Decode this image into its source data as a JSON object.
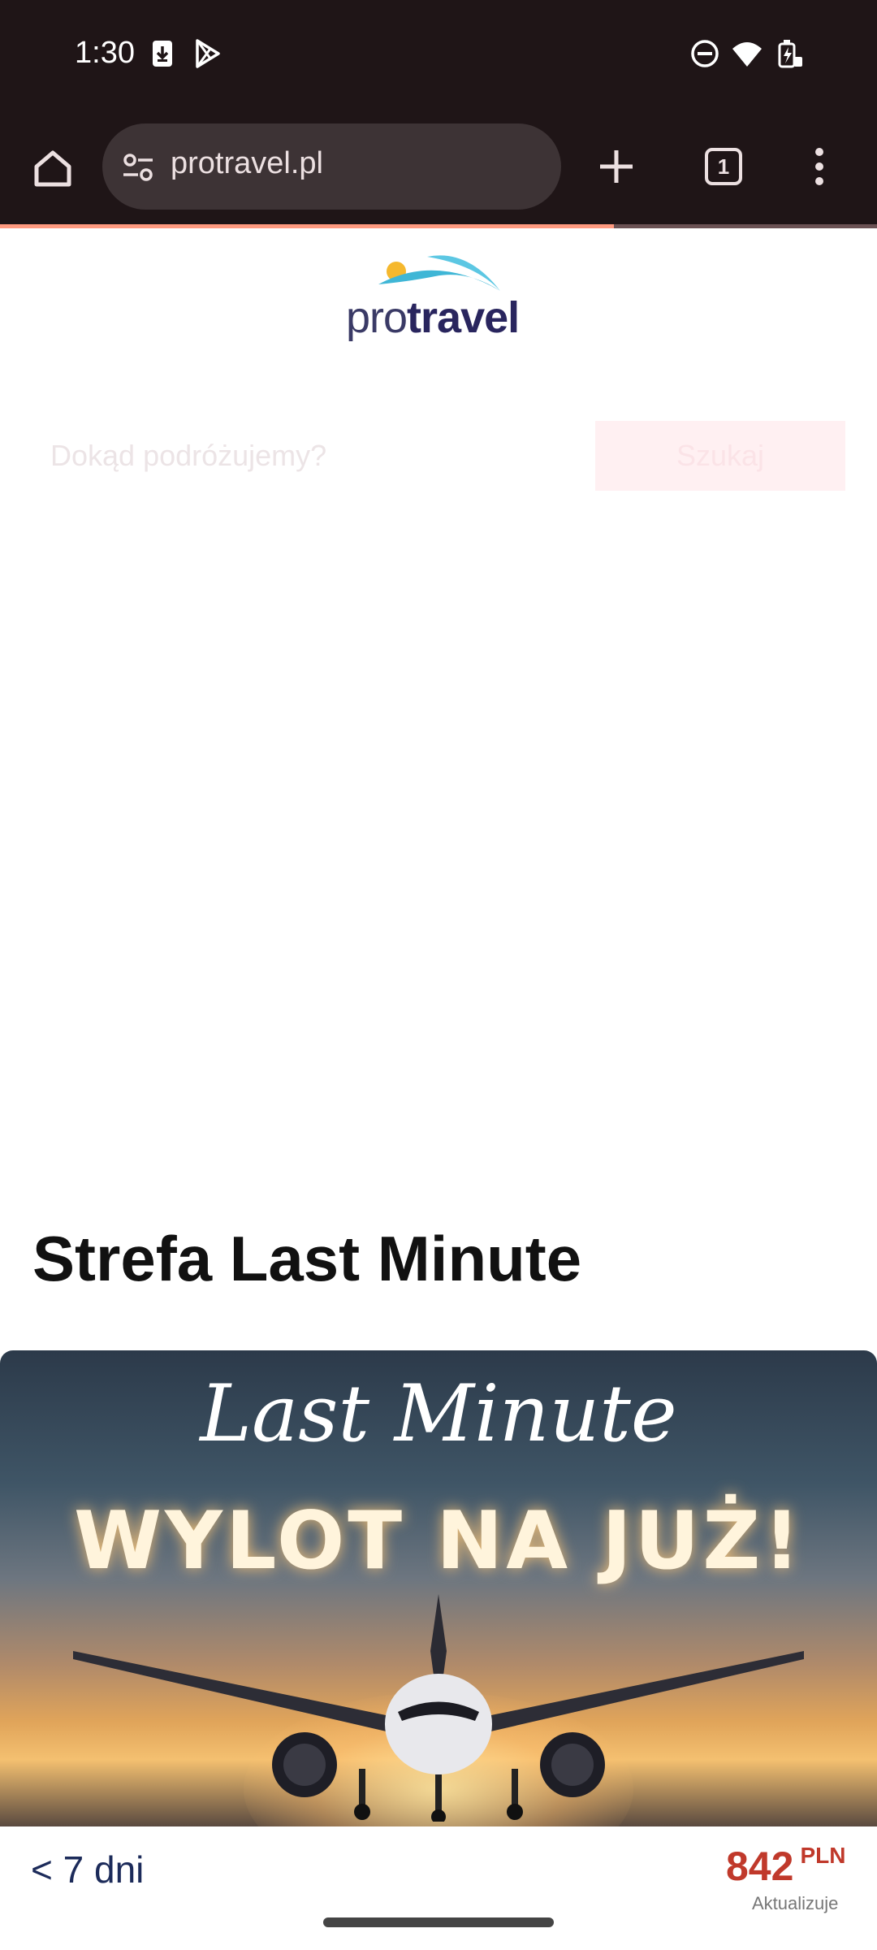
{
  "status_bar": {
    "time": "1:30",
    "icons": [
      "download-icon",
      "play-store-icon",
      "dnd-icon",
      "wifi-icon",
      "battery-icon"
    ]
  },
  "browser": {
    "url": "protravel.pl",
    "tab_count": "1",
    "load_progress": 0.7
  },
  "page": {
    "logo": {
      "pro": "pro",
      "travel": "travel"
    },
    "search": {
      "placeholder": "Dokąd podróżujemy?",
      "button_label": "Szukaj"
    },
    "section_title": "Strefa Last Minute",
    "banner": {
      "script_text": "Last Minute",
      "headline": "WYLOT NA JUŻ!"
    },
    "offer": {
      "days": "< 7 dni",
      "price": "842",
      "currency": "PLN",
      "price_note": "Aktualizuje"
    }
  },
  "colors": {
    "accent": "#c0392b",
    "brand_navy": "#29255e",
    "brand_sky": "#3fb6d6",
    "brand_sun": "#f5b82e"
  }
}
